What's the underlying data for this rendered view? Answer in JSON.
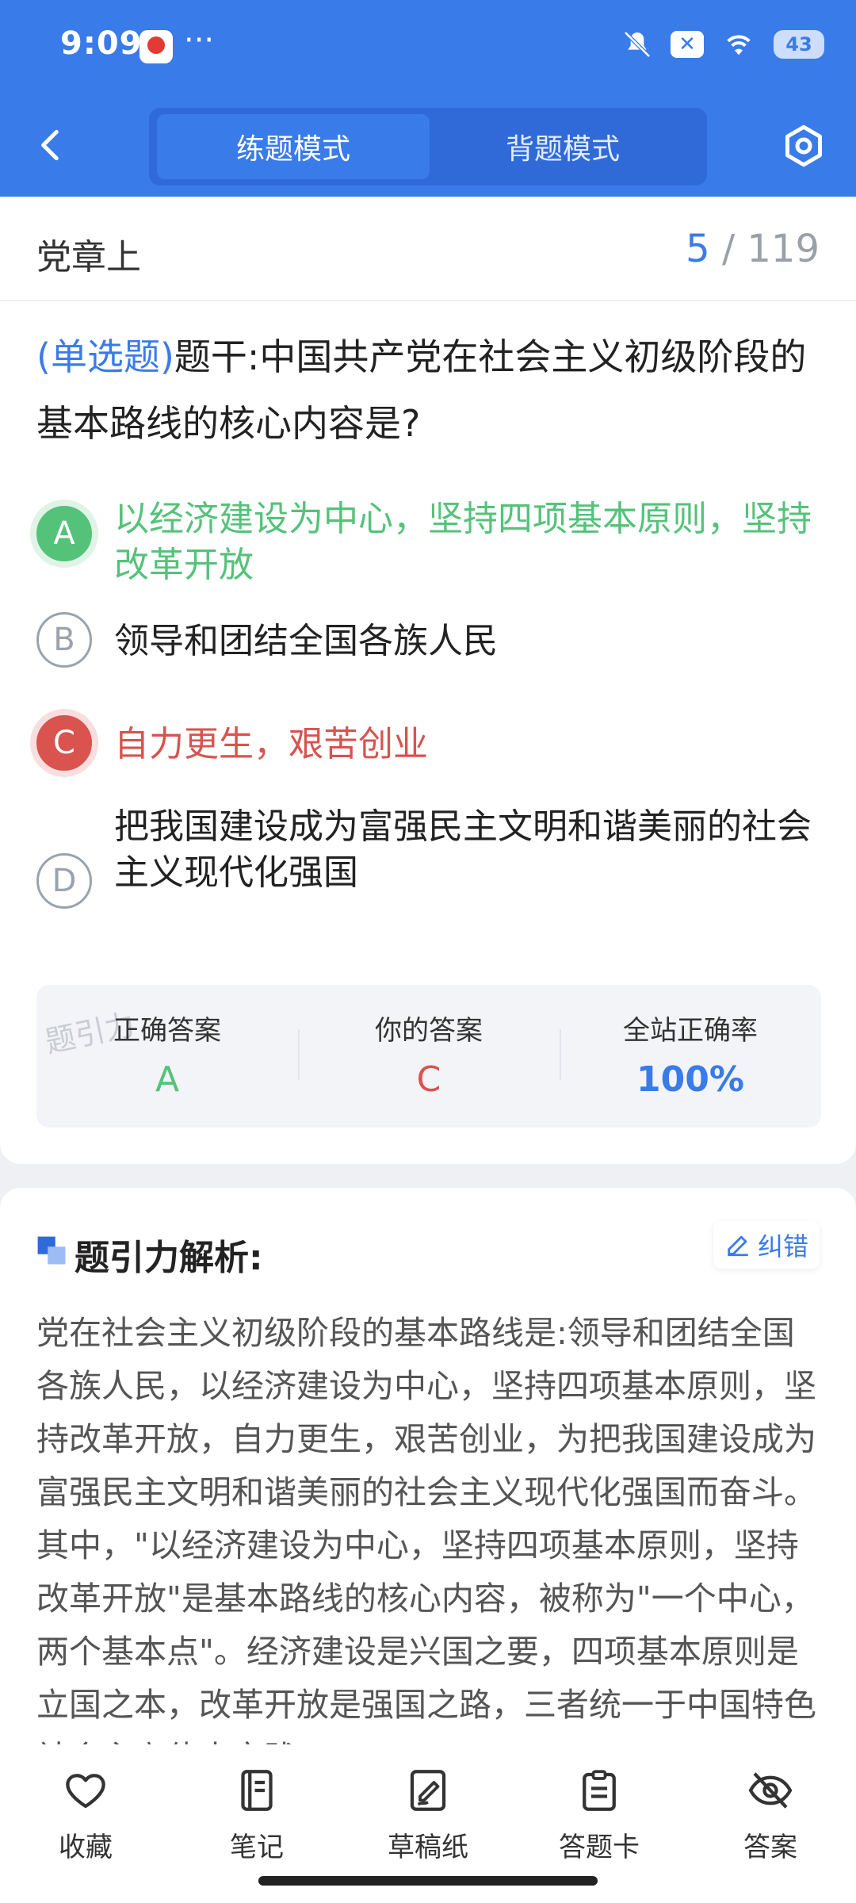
{
  "status_bar": {
    "time": "9:09",
    "dots": "···",
    "battery": "43",
    "icon_names": [
      "mute-bell-icon",
      "x-app-icon",
      "wifi-icon",
      "battery-icon"
    ]
  },
  "nav": {
    "tabs": [
      {
        "label": "练题模式",
        "active": true
      },
      {
        "label": "背题模式",
        "active": false
      }
    ]
  },
  "chapter": {
    "title": "党章上",
    "current": "5",
    "total": "/ 119"
  },
  "question": {
    "type": "(单选题)",
    "text": "题干:中国共产党在社会主义初级阶段的基本路线的核心内容是?"
  },
  "options": [
    {
      "letter": "A",
      "text": "以经济建设为中心，坚持四项基本原则，坚持改革开放",
      "state": "correct"
    },
    {
      "letter": "B",
      "text": "领导和团结全国各族人民",
      "state": "normal"
    },
    {
      "letter": "C",
      "text": "自力更生，艰苦创业",
      "state": "wrong"
    },
    {
      "letter": "D",
      "text": "把我国建设成为富强民主文明和谐美丽的社会主义现代化强国",
      "state": "normal"
    }
  ],
  "stats": {
    "correct_label": "正确答案",
    "correct_value": "A",
    "yours_label": "你的答案",
    "yours_value": "C",
    "rate_label": "全站正确率",
    "rate_value": "100%",
    "watermark": "题引力"
  },
  "explanation": {
    "title": "题引力解析:",
    "correction_label": "纠错",
    "text": "党在社会主义初级阶段的基本路线是:领导和团结全国各族人民，以经济建设为中心，坚持四项基本原则，坚持改革开放，自力更生，艰苦创业，为把我国建设成为富强民主文明和谐美丽的社会主义现代化强国而奋斗。其中，\"以经济建设为中心，坚持四项基本原则，坚持改革开放\"是基本路线的核心内容，被称为\"一个中心，两个基本点\"。经济建设是兴国之要，四项基本原则是立国之本，改革开放是强国之路，三者统一于中国特色社会主义伟大实践。"
  },
  "bottom_bar": {
    "items": [
      {
        "label": "收藏",
        "icon": "heart-icon"
      },
      {
        "label": "笔记",
        "icon": "notebook-icon"
      },
      {
        "label": "草稿纸",
        "icon": "draft-icon"
      },
      {
        "label": "答题卡",
        "icon": "clipboard-icon"
      },
      {
        "label": "答案",
        "icon": "eye-off-icon"
      }
    ]
  },
  "colors": {
    "accent": "#3a7bea",
    "correct": "#55c27a",
    "wrong": "#d9534f"
  }
}
